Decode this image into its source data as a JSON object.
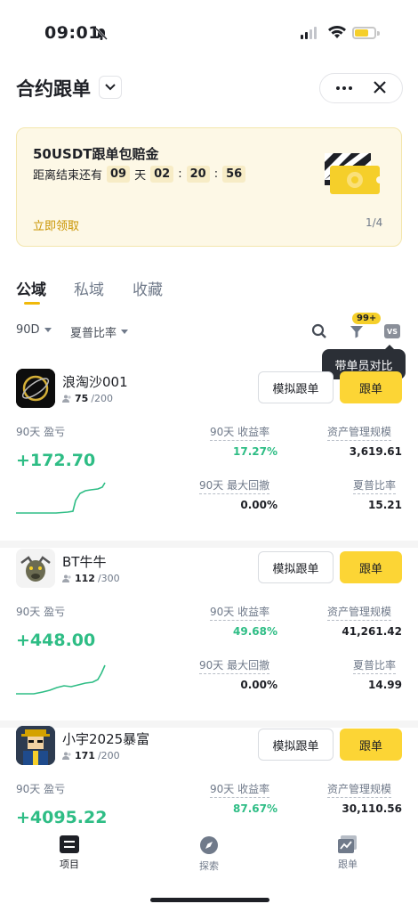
{
  "status_bar": {
    "time": "09:01"
  },
  "header": {
    "title": "合约跟单"
  },
  "promo": {
    "title": "50USDT跟单包赔金",
    "countdown_prefix": "距离结束还有",
    "days": "09",
    "days_unit": "天",
    "hours": "02",
    "minutes": "20",
    "seconds": "56",
    "sep": ":",
    "claim_label": "立即领取",
    "pager": "1/4"
  },
  "tabs": [
    {
      "label": "公域",
      "active": true
    },
    {
      "label": "私域",
      "active": false
    },
    {
      "label": "收藏",
      "active": false
    }
  ],
  "filters": {
    "period": "90D",
    "sort": "夏普比率"
  },
  "toolbar": {
    "badge": "99+",
    "vs_label": "VS",
    "tooltip": "带单员对比"
  },
  "labels": {
    "pnl": "90天 盈亏",
    "roi": "90天 收益率",
    "aum": "资产管理规模",
    "mdd": "90天 最大回撤",
    "sharpe": "夏普比率",
    "simulate": "模拟跟单",
    "copy": "跟单"
  },
  "traders": [
    {
      "name": "浪淘沙001",
      "members": "75",
      "capacity": "/200",
      "pnl": "+172.70",
      "roi": "17.27%",
      "aum": "3,619.61",
      "mdd": "0.00%",
      "sharpe": "15.21"
    },
    {
      "name": "BT牛牛",
      "members": "112",
      "capacity": "/300",
      "pnl": "+448.00",
      "roi": "49.68%",
      "aum": "41,261.42",
      "mdd": "0.00%",
      "sharpe": "14.99"
    },
    {
      "name": "小宇2025暴富",
      "members": "171",
      "capacity": "/200",
      "pnl": "+4095.22",
      "roi": "87.67%",
      "aum": "30,110.56"
    }
  ],
  "bottom_nav": [
    {
      "label": "项目",
      "active": true
    },
    {
      "label": "探索",
      "active": false
    },
    {
      "label": "跟单",
      "active": false
    }
  ],
  "colors": {
    "brand_yellow": "#fcd535",
    "positive_green": "#2ebd85",
    "tooltip_bg": "#2b2f36"
  }
}
